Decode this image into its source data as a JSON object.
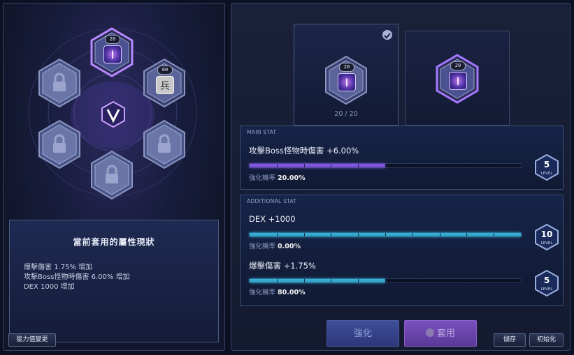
{
  "nodes": {
    "top": {
      "level": "20",
      "icon": "rune-i-icon"
    },
    "upper_right": {
      "level": "00",
      "icon": "rune-soldier-icon"
    },
    "center_icon": "v-emblem-icon",
    "locked_icon": "lock-icon"
  },
  "summary": {
    "title": "當前套用的屬性現狀",
    "lines": [
      "爆擊傷害 1.75% 增加",
      "攻擊Boss怪物時傷害 6.00% 增加",
      "DEX 1000 增加"
    ]
  },
  "buttons": {
    "change_stats": "能力值變更",
    "enhance": "強化",
    "apply": "套用",
    "save": "儲存",
    "reset": "初始化"
  },
  "slots": {
    "selected": {
      "level": "20",
      "progress": "20 / 20",
      "check_icon": "check-icon"
    },
    "compare": {
      "level": "20"
    }
  },
  "main_stat": {
    "section_label": "MAIN STAT",
    "name": "攻擊Boss怪物時傷害 +6.00%",
    "prob_label": "強化機率",
    "prob_value": "20.00%",
    "level": "5",
    "level_caption": "LEVEL",
    "fill": 0.5
  },
  "additional_stat": {
    "section_label": "ADDITIONAL STAT",
    "stats": [
      {
        "name": "DEX +1000",
        "prob_label": "強化機率",
        "prob_value": "0.00%",
        "level": "10",
        "level_caption": "LEVEL",
        "fill": 1.0
      },
      {
        "name": "爆擊傷害 +1.75%",
        "prob_label": "強化機率",
        "prob_value": "80.00%",
        "level": "5",
        "level_caption": "LEVEL",
        "fill": 0.5
      }
    ]
  },
  "colors": {
    "main_bar": "#8a5cf0",
    "additional_bar": "#38b8e0",
    "accent_purple": "#a874ff"
  }
}
